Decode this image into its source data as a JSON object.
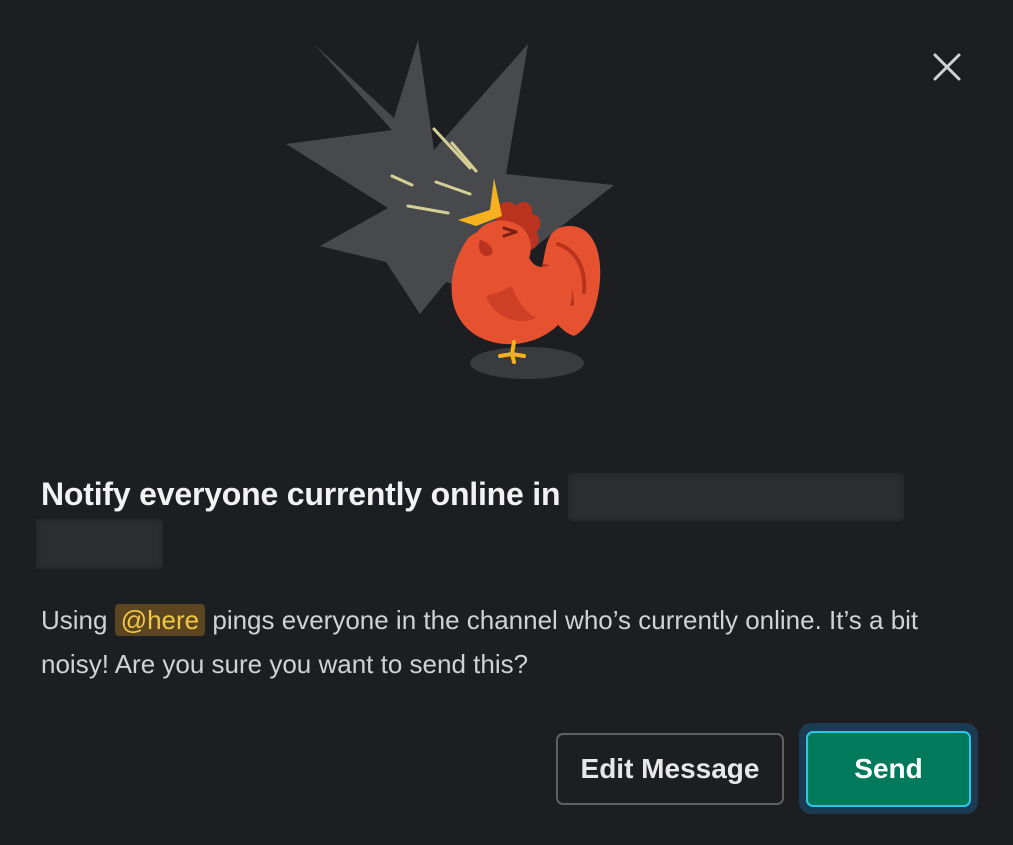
{
  "modal": {
    "close_label": "Close",
    "title": "Notify everyone currently online in",
    "body_before": "Using ",
    "mention": "@here",
    "body_after": " pings everyone in the channel who’s currently online. It’s a bit noisy! Are you sure you want to send this?",
    "buttons": {
      "edit": "Edit Message",
      "send": "Send"
    }
  },
  "colors": {
    "background": "#1d1e22",
    "primary": "#007a5a",
    "focus_ring": "#2dc6e8",
    "mention_bg": "#5b4621",
    "mention_fg": "#f2c744",
    "rooster": "#e65130"
  },
  "icons": {
    "close": "close-icon",
    "illustration": "rooster-illustration"
  }
}
